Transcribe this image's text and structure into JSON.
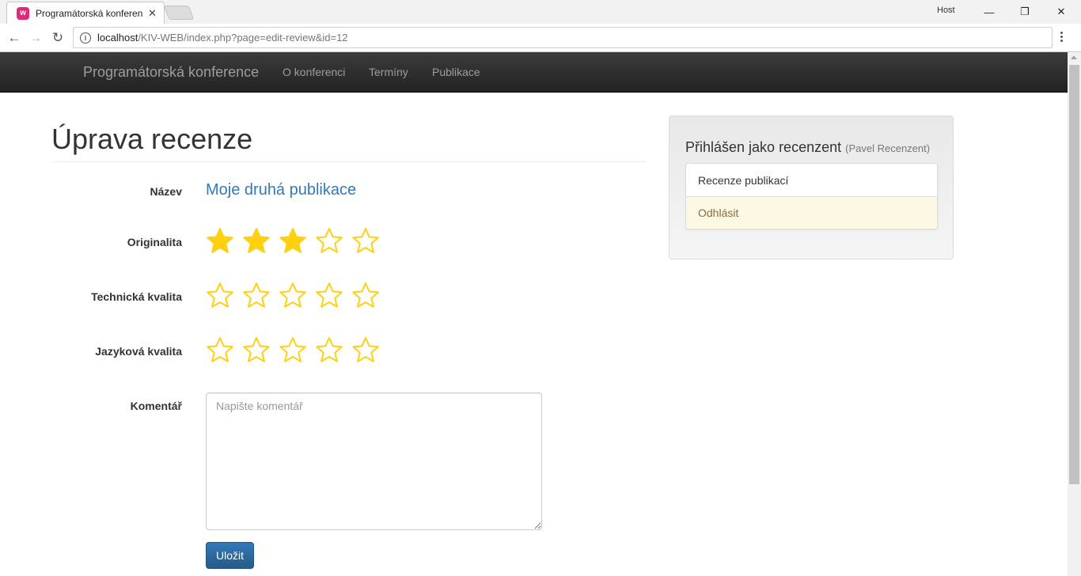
{
  "browser": {
    "tab_title": "Programátorská konferen",
    "tab_favicon": "w",
    "profile": "Host",
    "url_host": "localhost",
    "url_path": "/KIV-WEB/index.php?page=edit-review&id=12"
  },
  "navbar": {
    "brand": "Programátorská konference",
    "links": [
      "O konferenci",
      "Termíny",
      "Publikace"
    ]
  },
  "main": {
    "title": "Úprava recenze",
    "name_label": "Název",
    "publication_name": "Moje druhá publikace",
    "ratings": [
      {
        "label": "Originalita",
        "value": 3,
        "max": 5
      },
      {
        "label": "Technická kvalita",
        "value": 0,
        "max": 5
      },
      {
        "label": "Jazyková kvalita",
        "value": 0,
        "max": 5
      }
    ],
    "comment_label": "Komentář",
    "comment_placeholder": "Napište komentář",
    "comment_value": "",
    "save_label": "Uložit"
  },
  "sidebar": {
    "title": "Přihlášen jako recenzent",
    "user": "(Pavel Recenzent)",
    "items": [
      {
        "label": "Recenze publikací"
      },
      {
        "label": "Odhlásit"
      }
    ]
  },
  "colors": {
    "star": "#ffd012",
    "link": "#337ab7",
    "primary": "#337ab7"
  },
  "icons": {
    "back": "arrow-left-icon",
    "forward": "arrow-right-icon",
    "reload": "reload-icon",
    "info": "info-icon",
    "menu": "more-vertical-icon",
    "rating": "star-icon"
  }
}
